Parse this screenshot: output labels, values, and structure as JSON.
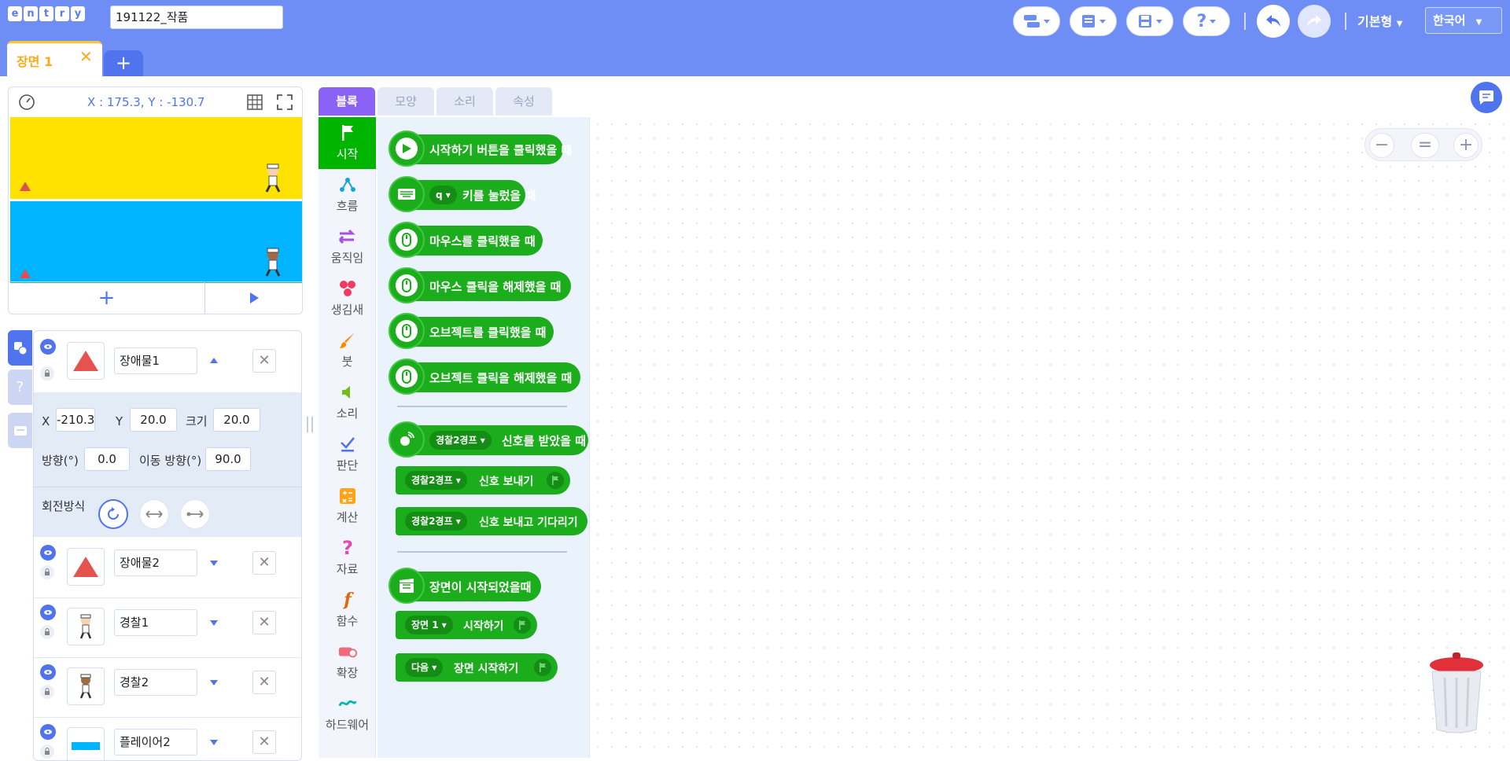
{
  "header": {
    "logo_letters": [
      "e",
      "n",
      "t",
      "r",
      "y"
    ],
    "project_title": "191122_작품",
    "mode_label": "기본형",
    "language": "한국어"
  },
  "scene": {
    "tab_label": "장면 1",
    "close": "✕",
    "add": "+"
  },
  "stage": {
    "coordinates": "X : 175.3, Y : -130.7",
    "add_label": "+"
  },
  "object_detail": {
    "x_label": "X",
    "x_value": "-210.3",
    "y_label": "Y",
    "y_value": "20.0",
    "size_label": "크기",
    "size_value": "20.0",
    "direction_label": "방향(°)",
    "direction_value": "0.0",
    "move_dir_label": "이동 방향(°)",
    "move_dir_value": "90.0",
    "rotation_label": "회전방식"
  },
  "objects": [
    {
      "name": "장애물1"
    },
    {
      "name": "장애물2"
    },
    {
      "name": "경찰1"
    },
    {
      "name": "경찰2"
    },
    {
      "name": "플레이어2"
    }
  ],
  "workspace_tabs": [
    "블록",
    "모양",
    "소리",
    "속성"
  ],
  "categories": [
    "시작",
    "흐름",
    "움직임",
    "생김새",
    "붓",
    "소리",
    "판단",
    "계산",
    "자료",
    "함수",
    "확장",
    "하드웨어"
  ],
  "blocks": {
    "b1": "시작하기 버튼을 클릭했을 때",
    "b2_key": "q",
    "b2": "키를 눌렀을 때",
    "b3": "마우스를 클릭했을 때",
    "b4": "마우스 클릭을 해제했을 때",
    "b5": "오브젝트를 클릭했을 때",
    "b6": "오브젝트 클릭을 해제했을 때",
    "signal": "경찰2경프",
    "b7": "신호를 받았을 때",
    "b8": "신호 보내기",
    "b9": "신호 보내고 기다리기",
    "b10": "장면이 시작되었을때",
    "scene_dd": "장면 1",
    "b11": "시작하기",
    "next_dd": "다음",
    "b12": "장면 시작하기"
  },
  "zoom": {
    "minus": "−",
    "reset": "=",
    "plus": "+"
  },
  "colors": {
    "header": "#6e8ef5",
    "start_category": "#00b400",
    "block_green": "#1bad1b",
    "accent": "#4f74ee"
  }
}
